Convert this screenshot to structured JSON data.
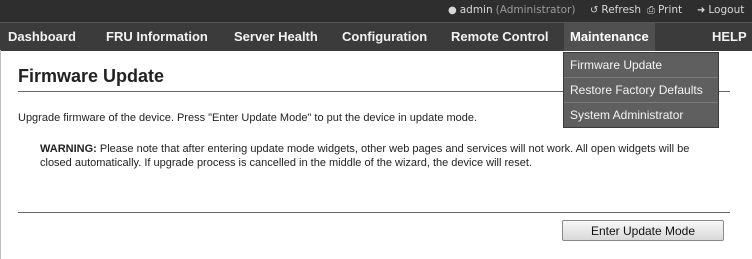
{
  "topbar": {
    "user": "admin",
    "role": "(Administrator)",
    "refresh": "Refresh",
    "print": "Print",
    "logout": "Logout"
  },
  "nav": {
    "items": [
      {
        "label": "Dashboard"
      },
      {
        "label": "FRU Information"
      },
      {
        "label": "Server Health"
      },
      {
        "label": "Configuration"
      },
      {
        "label": "Remote Control"
      },
      {
        "label": "Maintenance"
      },
      {
        "label": "HELP"
      }
    ],
    "active": "Maintenance"
  },
  "dropdown": {
    "items": [
      {
        "label": "Firmware Update"
      },
      {
        "label": "Restore Factory Defaults"
      },
      {
        "label": "System Administrator"
      }
    ]
  },
  "main": {
    "title": "Firmware Update",
    "intro": "Upgrade firmware of the device. Press \"Enter Update Mode\" to put the device in update mode.",
    "warning_label": "WARNING:",
    "warning_text": " Please note that after entering update mode widgets, other web pages and services will not work. All open widgets will be closed automatically. If upgrade process is cancelled in the middle of the wizard, the device will reset.",
    "button_label": "Enter Update Mode"
  },
  "colors": {
    "topbar_bg": "#2e2e2e",
    "navbar_bg": "#3b3b3b",
    "active_tab_bg": "#505050",
    "dropdown_bg": "#5f5f5f"
  }
}
